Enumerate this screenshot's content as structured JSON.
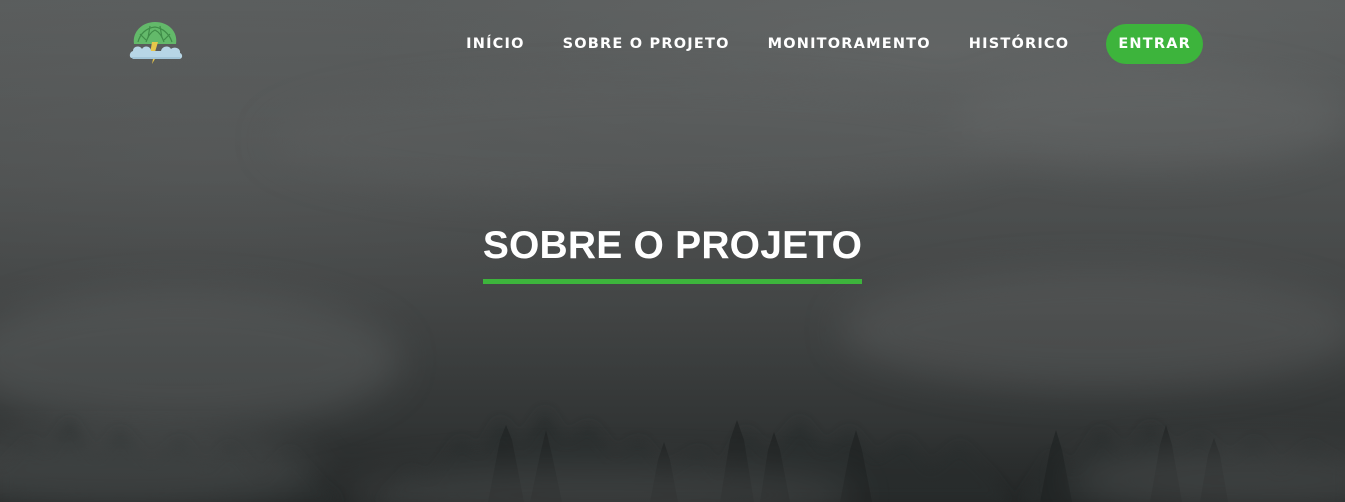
{
  "nav": {
    "logo_alt": "logo",
    "items": [
      {
        "label": "INÍCIO"
      },
      {
        "label": "SOBRE O PROJETO"
      },
      {
        "label": "MONITORAMENTO"
      },
      {
        "label": "HISTÓRICO"
      }
    ],
    "login_label": "ENTRAR"
  },
  "hero": {
    "title": "SOBRE O PROJETO",
    "background_icon": "foggy-forest-image"
  },
  "colors": {
    "accent": "#3db43c",
    "text": "#ffffff",
    "background": "#565959"
  }
}
